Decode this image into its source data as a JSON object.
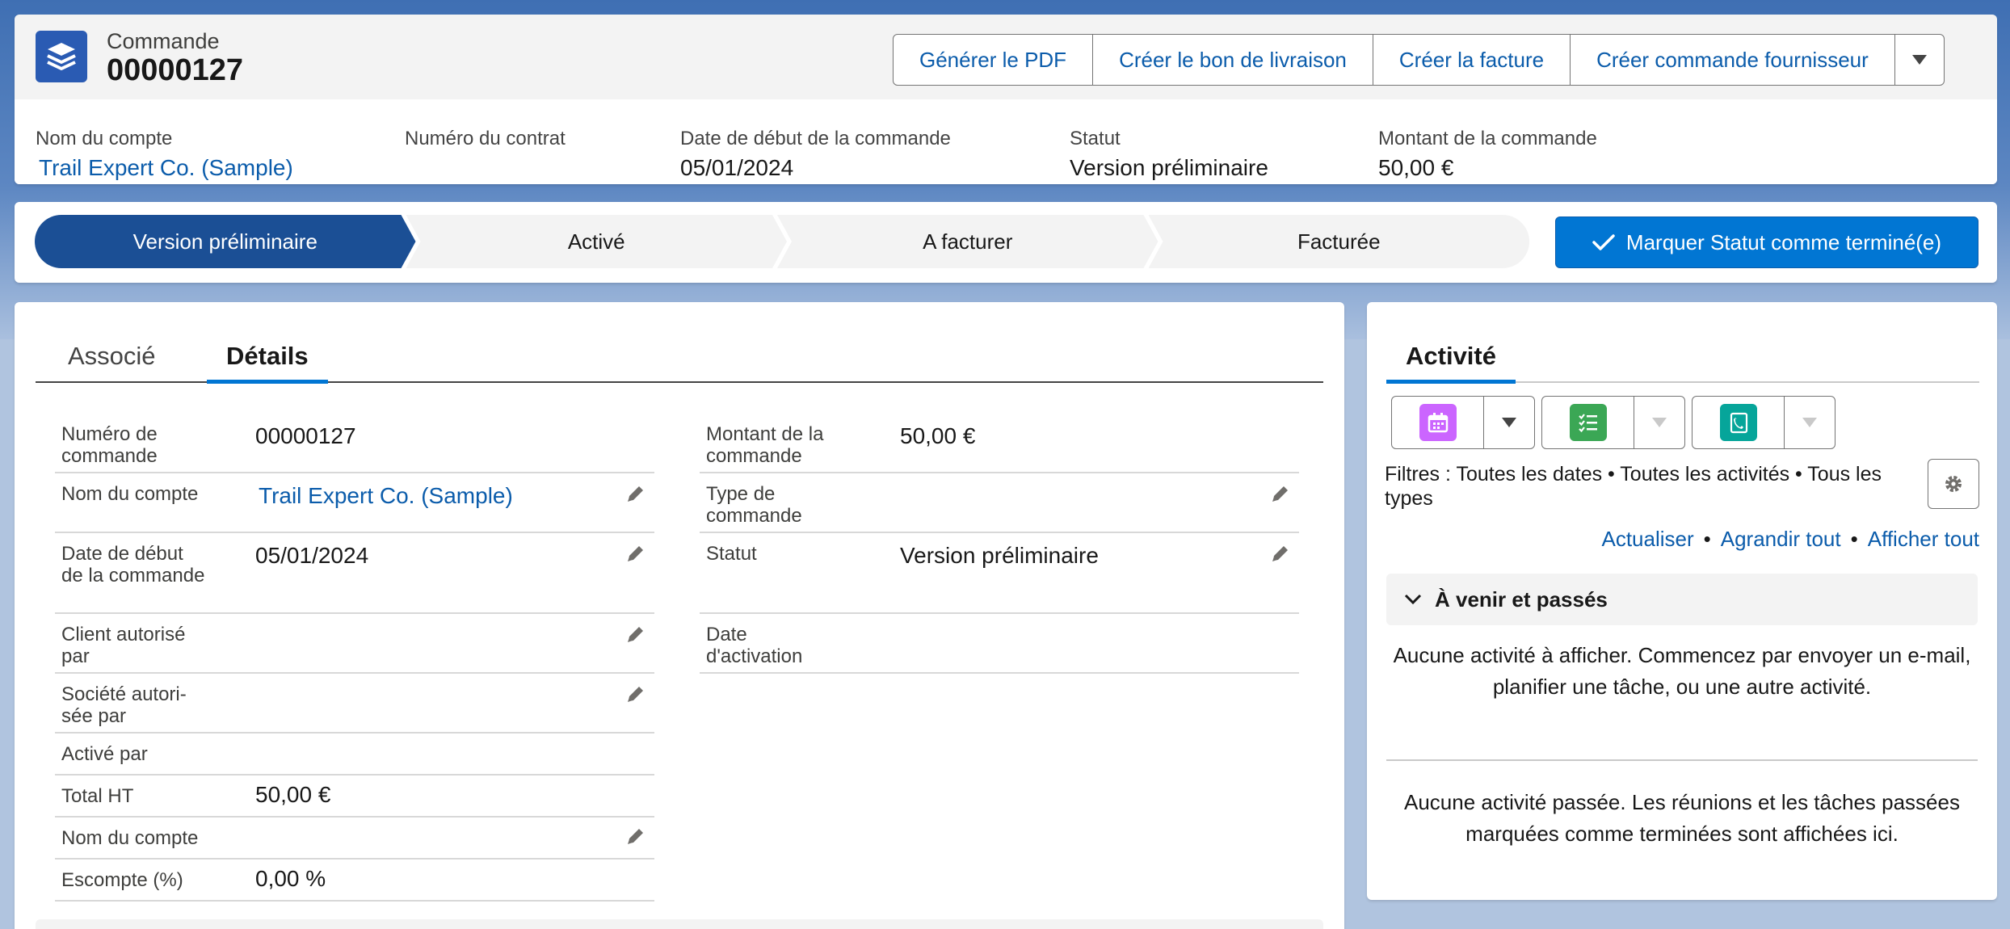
{
  "header": {
    "object_type": "Commande",
    "record_name": "00000127",
    "actions": [
      "Générer le PDF",
      "Créer le bon de livraison",
      "Créer la facture",
      "Créer commande fournisseur"
    ],
    "highlights": [
      {
        "label": "Nom du compte",
        "value": "Trail Expert Co. (Sample)"
      },
      {
        "label": "Numéro du contrat",
        "value": ""
      },
      {
        "label": "Date de début de la commande",
        "value": "05/01/2024"
      },
      {
        "label": "Statut",
        "value": "Version préliminaire"
      },
      {
        "label": "Montant de la commande",
        "value": "50,00 €"
      }
    ]
  },
  "path": {
    "steps": [
      "Version préliminaire",
      "Activé",
      "A facturer",
      "Facturée"
    ],
    "current_index": 0,
    "mark_button": "Marquer Statut comme terminé(e)"
  },
  "details": {
    "tabs": [
      "Associé",
      "Détails"
    ],
    "active_tab": "Détails",
    "left_fields": [
      {
        "label": "Numéro de commande",
        "value": ""
      },
      {
        "label": "Nom du compte",
        "value": "Trail Expert Co. (Sample)"
      },
      {
        "label": "Date de début de la commande",
        "value": "05/01/2024"
      },
      {
        "label": "Client autorisé par",
        "value": ""
      },
      {
        "label": "Société autori-sée par",
        "value": ""
      },
      {
        "label": "Activé par",
        "value": ""
      },
      {
        "label": "Total HT",
        "value": "50,00 €"
      },
      {
        "label": "Nom du compte",
        "value": ""
      },
      {
        "label": "Escompte (%)",
        "value": "0,00 %"
      }
    ],
    "order_number_value": "00000127",
    "right_fields": [
      {
        "label": "Montant de la commande",
        "value": "50,00 €"
      },
      {
        "label": "Type de commande",
        "value": ""
      },
      {
        "label": "Statut",
        "value": "Version préliminaire"
      },
      {
        "label": "Date d'activation",
        "value": ""
      }
    ]
  },
  "activity": {
    "tab": "Activité",
    "filters": "Filtres : Toutes les dates • Toutes les activités • Tous les types",
    "links": [
      "Actualiser",
      "Agrandir tout",
      "Afficher tout"
    ],
    "section_title": "À venir et passés",
    "empty_upcoming": "Aucune activité à afficher. Commencez par envoyer un e-mail, planifier une tâche, ou une autre activité.",
    "empty_past": "Aucune activité passée. Les réunions et les tâches passées marquées comme terminées sont affichées ici.",
    "icons": {
      "event": "calendar-icon",
      "task": "task-list-icon",
      "call": "phone-icon"
    },
    "colors": {
      "event": "#cb65ff",
      "task": "#3ba755",
      "call": "#0d9dda"
    }
  },
  "colors": {
    "brand": "#0176d3",
    "path_current": "#1b4f95",
    "link": "#0b5cab"
  }
}
